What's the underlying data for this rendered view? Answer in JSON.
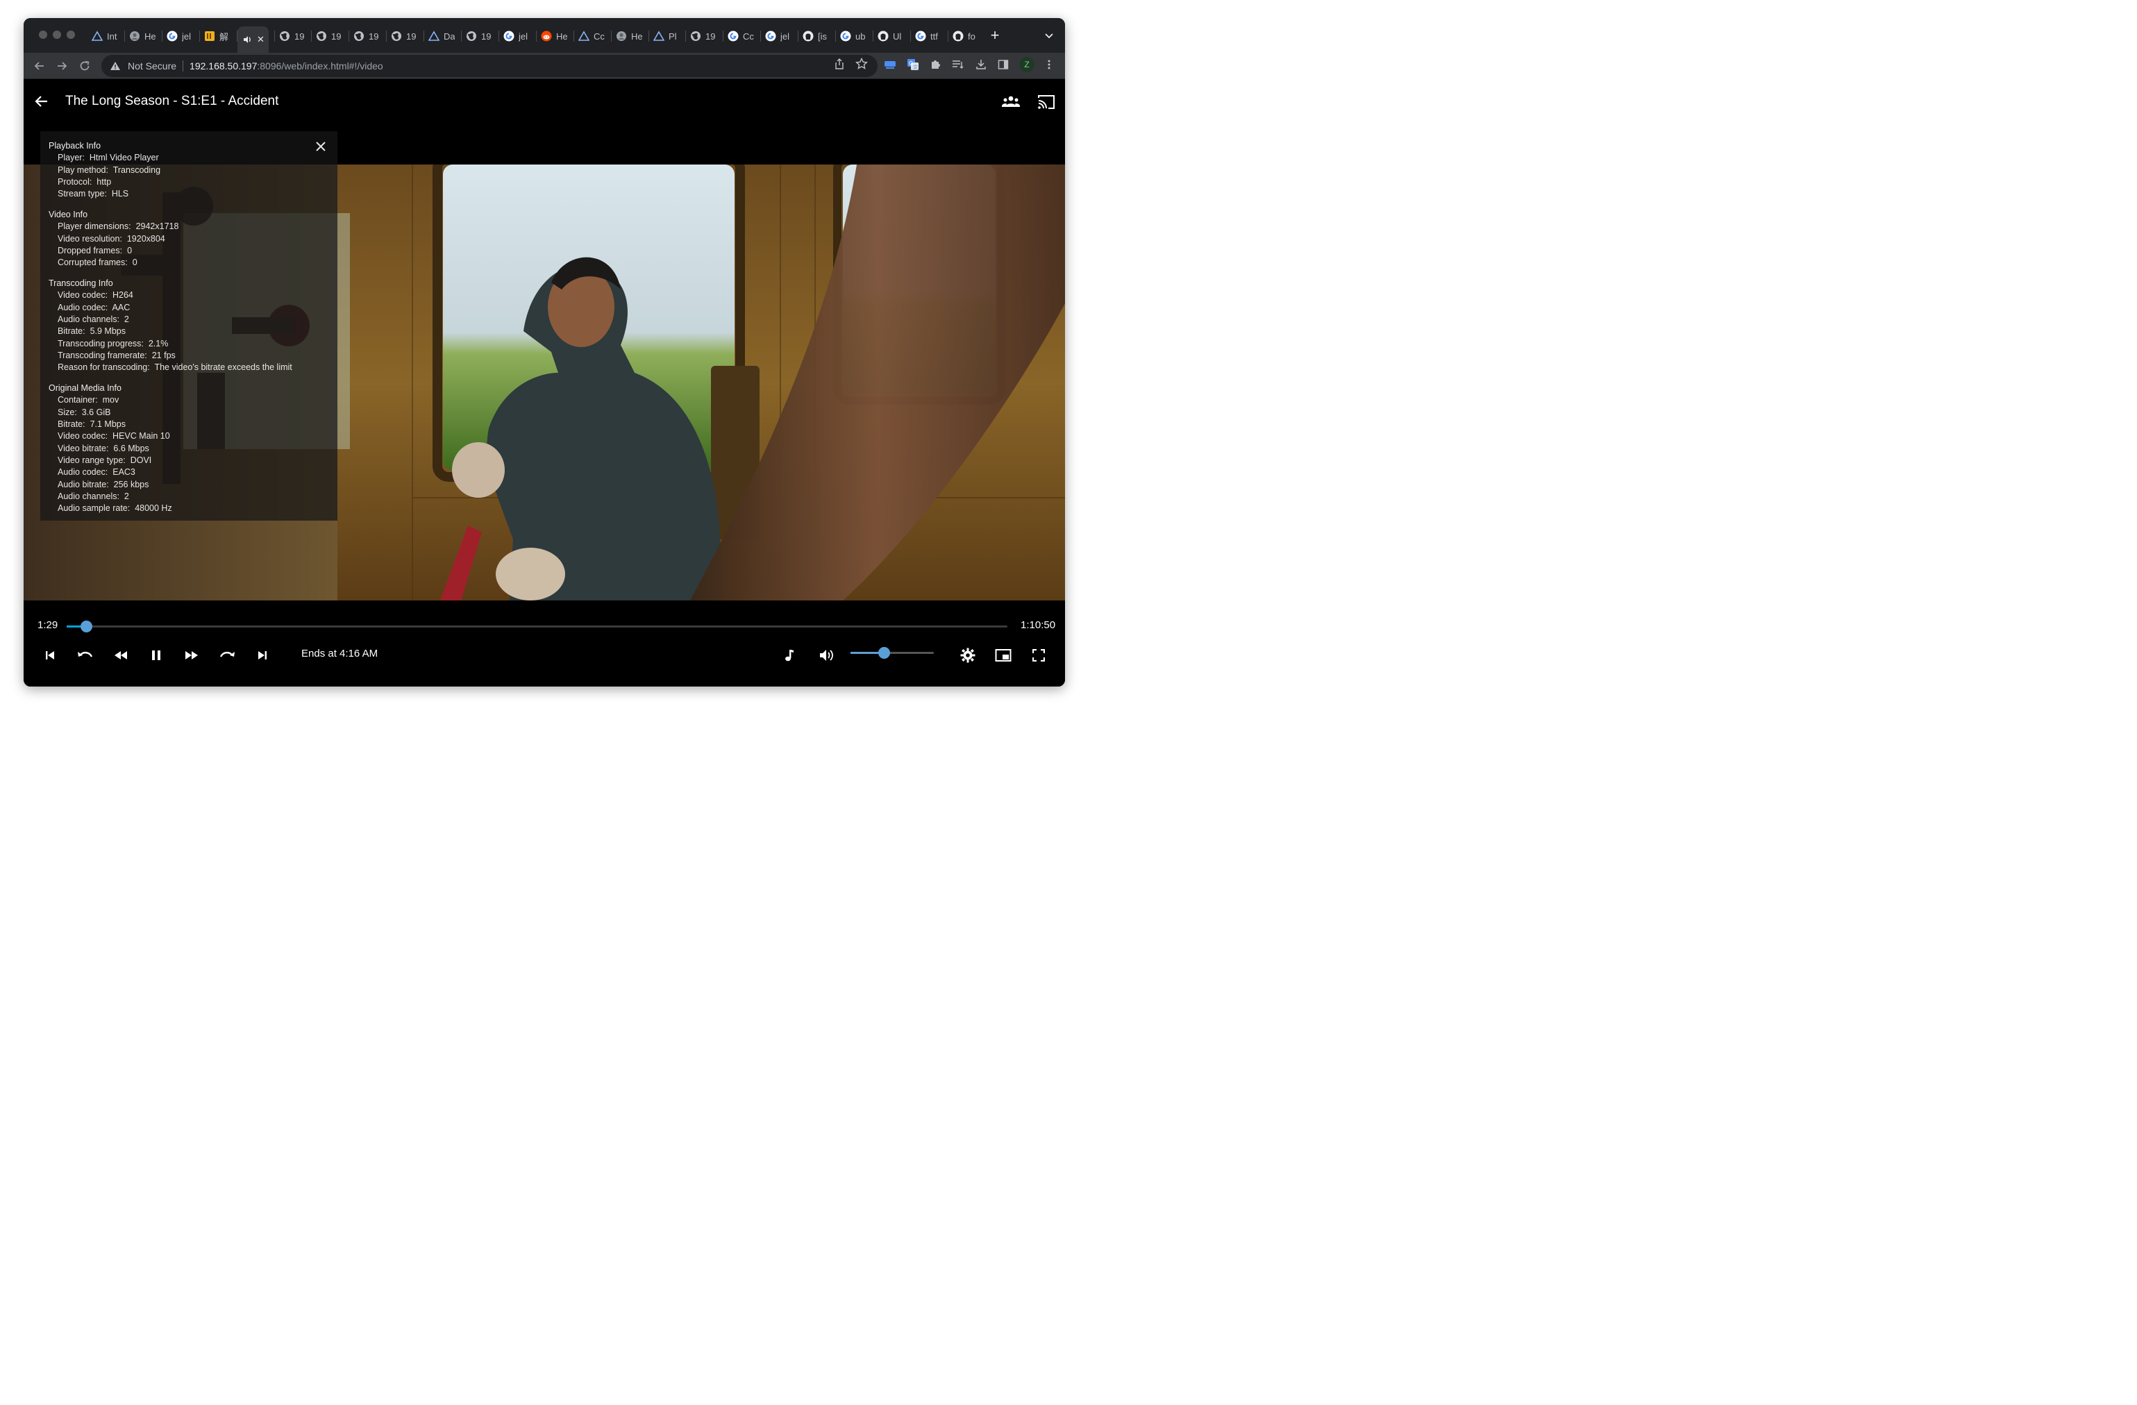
{
  "browser": {
    "tabs": [
      {
        "title": "Int",
        "icon": "arc-triangle-icon"
      },
      {
        "title": "He",
        "icon": "avatar-icon"
      },
      {
        "title": "jel",
        "icon": "google-icon"
      },
      {
        "title": "解",
        "icon": "app-icon"
      },
      {
        "title": "",
        "icon": "audio-icon",
        "active": true
      },
      {
        "title": "19",
        "icon": "globe-icon"
      },
      {
        "title": "19",
        "icon": "globe-icon"
      },
      {
        "title": "19",
        "icon": "globe-icon"
      },
      {
        "title": "19",
        "icon": "globe-icon"
      },
      {
        "title": "Da",
        "icon": "arc-triangle-icon"
      },
      {
        "title": "19",
        "icon": "globe-icon"
      },
      {
        "title": "jel",
        "icon": "google-icon"
      },
      {
        "title": "He",
        "icon": "reddit-icon"
      },
      {
        "title": "Cc",
        "icon": "arc-triangle-icon"
      },
      {
        "title": "He",
        "icon": "avatar-icon"
      },
      {
        "title": "Pl",
        "icon": "arc-triangle-icon"
      },
      {
        "title": "19",
        "icon": "globe-icon"
      },
      {
        "title": "Cc",
        "icon": "google-icon"
      },
      {
        "title": "jel",
        "icon": "google-icon"
      },
      {
        "title": "[is",
        "icon": "github-icon"
      },
      {
        "title": "ub",
        "icon": "google-icon"
      },
      {
        "title": "Ul",
        "icon": "github-icon"
      },
      {
        "title": "ttf",
        "icon": "google-icon"
      },
      {
        "title": "fo",
        "icon": "github-icon"
      }
    ],
    "new_tab": "+",
    "address": {
      "security_label": "Not Secure",
      "host": "192.168.50.197",
      "path": ":8096/web/index.html#!/video"
    },
    "profile_initial": "Z"
  },
  "player": {
    "title": "The Long Season - S1:E1 - Accident",
    "current_time": "1:29",
    "duration": "1:10:50",
    "progress_fraction": 0.021,
    "volume_fraction": 0.4,
    "ends_at": "Ends at 4:16 AM"
  },
  "playback_info": {
    "sections": [
      {
        "heading": "Playback Info",
        "rows": [
          {
            "key": "Player:",
            "value": "Html Video Player"
          },
          {
            "key": "Play method:",
            "value": "Transcoding"
          },
          {
            "key": "Protocol:",
            "value": "http"
          },
          {
            "key": "Stream type:",
            "value": "HLS"
          }
        ]
      },
      {
        "heading": "Video Info",
        "rows": [
          {
            "key": "Player dimensions:",
            "value": "2942x1718"
          },
          {
            "key": "Video resolution:",
            "value": "1920x804"
          },
          {
            "key": "Dropped frames:",
            "value": "0"
          },
          {
            "key": "Corrupted frames:",
            "value": "0"
          }
        ]
      },
      {
        "heading": "Transcoding Info",
        "rows": [
          {
            "key": "Video codec:",
            "value": "H264"
          },
          {
            "key": "Audio codec:",
            "value": "AAC"
          },
          {
            "key": "Audio channels:",
            "value": "2"
          },
          {
            "key": "Bitrate:",
            "value": "5.9 Mbps"
          },
          {
            "key": "Transcoding progress:",
            "value": "2.1%"
          },
          {
            "key": "Transcoding framerate:",
            "value": "21 fps"
          },
          {
            "key": "Reason for transcoding:",
            "value": "The video's bitrate exceeds the limit"
          }
        ]
      },
      {
        "heading": "Original Media Info",
        "rows": [
          {
            "key": "Container:",
            "value": "mov"
          },
          {
            "key": "Size:",
            "value": "3.6 GiB"
          },
          {
            "key": "Bitrate:",
            "value": "7.1 Mbps"
          },
          {
            "key": "Video codec:",
            "value": "HEVC Main 10"
          },
          {
            "key": "Video bitrate:",
            "value": "6.6 Mbps"
          },
          {
            "key": "Video range type:",
            "value": "DOVI"
          },
          {
            "key": "Audio codec:",
            "value": "EAC3"
          },
          {
            "key": "Audio bitrate:",
            "value": "256 kbps"
          },
          {
            "key": "Audio channels:",
            "value": "2"
          },
          {
            "key": "Audio sample rate:",
            "value": "48000 Hz"
          }
        ]
      }
    ]
  },
  "colors": {
    "accent": "#00a4dc",
    "thumb": "#5aa0d8",
    "browser_chrome": "#202124",
    "toolbar": "#35363a"
  }
}
